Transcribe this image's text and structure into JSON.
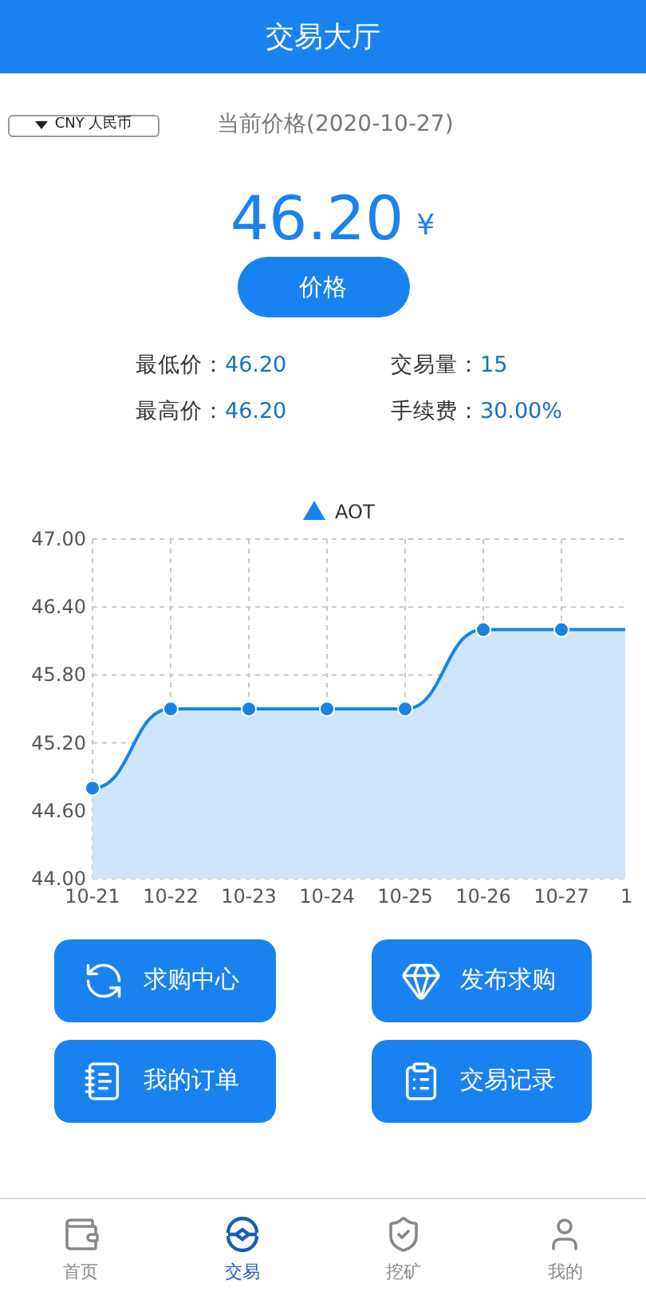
{
  "header": {
    "title": "交易大厅"
  },
  "currency_select": {
    "value": "CNY 人民币"
  },
  "price_date": "当前价格(2020-10-27)",
  "price": {
    "value": "46.20",
    "unit": "¥"
  },
  "price_button": "价格",
  "stats": [
    {
      "label": "最低价：",
      "value": "46.20"
    },
    {
      "label": "交易量：",
      "value": "15"
    },
    {
      "label": "最高价：",
      "value": "46.20"
    },
    {
      "label": "手续费：",
      "value": "30.00%"
    }
  ],
  "chart": {
    "chart_data": {
      "type": "area",
      "grid": true,
      "categories": [
        "10-21",
        "10-22",
        "10-23",
        "10-24",
        "10-25",
        "10-26",
        "10-27",
        "1"
      ],
      "series": [
        {
          "name": "AOT",
          "color": "#1a82e6",
          "values": [
            44.8,
            45.5,
            45.5,
            45.5,
            45.5,
            46.2,
            46.2,
            46.2
          ]
        }
      ],
      "ylim": [
        44,
        47
      ],
      "yticks": [
        {
          "value": 44,
          "label": "44.00"
        },
        {
          "value": 44.6,
          "label": "44.60"
        },
        {
          "value": 45.2,
          "label": "45.20"
        },
        {
          "value": 45.8,
          "label": "45.80"
        },
        {
          "value": 46.4,
          "label": "46.40"
        },
        {
          "value": 47,
          "label": "47.00"
        }
      ]
    }
  },
  "actions": [
    {
      "label": "求购中心",
      "kind": "exchange"
    },
    {
      "label": "发布求购",
      "kind": "gem"
    },
    {
      "label": "我的订单",
      "kind": "order"
    },
    {
      "label": "交易记录",
      "kind": "record"
    }
  ],
  "tabs": [
    {
      "label": "首页",
      "kind": "wallet",
      "selected": false
    },
    {
      "label": "交易",
      "kind": "trade",
      "selected": true
    },
    {
      "label": "挖矿",
      "kind": "mine",
      "selected": false
    },
    {
      "label": "我的",
      "kind": "user",
      "selected": false
    }
  ]
}
